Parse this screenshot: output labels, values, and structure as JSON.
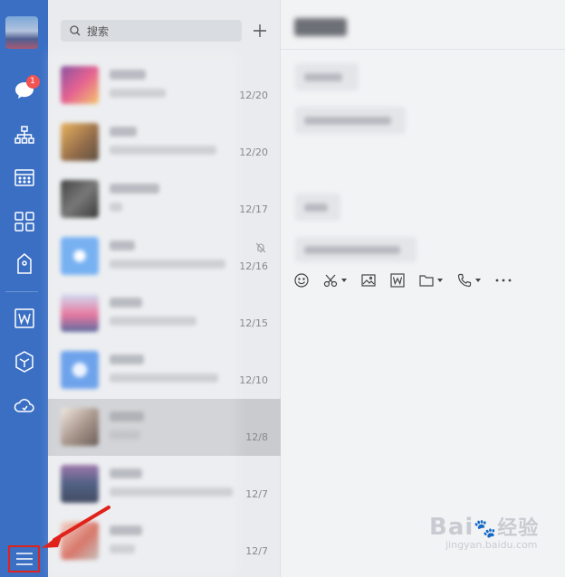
{
  "rail": {
    "unread_badge": "1",
    "items": [
      {
        "name": "messages",
        "icon": "chat-bubble-icon"
      },
      {
        "name": "contacts",
        "icon": "org-tree-icon"
      },
      {
        "name": "calendar",
        "icon": "calendar-icon"
      },
      {
        "name": "workbench",
        "icon": "apps-grid-icon"
      },
      {
        "name": "wallet",
        "icon": "bag-icon"
      },
      {
        "name": "documents",
        "icon": "w-doc-icon"
      },
      {
        "name": "cube",
        "icon": "cube-icon"
      },
      {
        "name": "cloud",
        "icon": "cloud-icon"
      }
    ],
    "menu_icon": "hamburger-menu-icon",
    "accent_color": "#3a6fc4",
    "highlight_color": "#e0221b"
  },
  "search": {
    "placeholder": "搜索"
  },
  "conversations": [
    {
      "date": "12/20",
      "selected": false,
      "muted": false
    },
    {
      "date": "12/20",
      "selected": false,
      "muted": false
    },
    {
      "date": "12/17",
      "selected": false,
      "muted": false
    },
    {
      "date": "12/16",
      "selected": false,
      "muted": true
    },
    {
      "date": "12/15",
      "selected": false,
      "muted": false
    },
    {
      "date": "12/10",
      "selected": false,
      "muted": false
    },
    {
      "date": "12/8",
      "selected": true,
      "muted": false
    },
    {
      "date": "12/7",
      "selected": false,
      "muted": false
    },
    {
      "date": "12/7",
      "selected": false,
      "muted": false
    }
  ],
  "toolbar": {
    "tools": [
      "emoji-icon",
      "scissors-icon",
      "image-icon",
      "w-doc-icon",
      "folder-icon",
      "phone-icon",
      "more-icon"
    ]
  },
  "watermark": {
    "brand": "Bai",
    "brand_suffix": "经验",
    "url": "jingyan.baidu.com"
  }
}
